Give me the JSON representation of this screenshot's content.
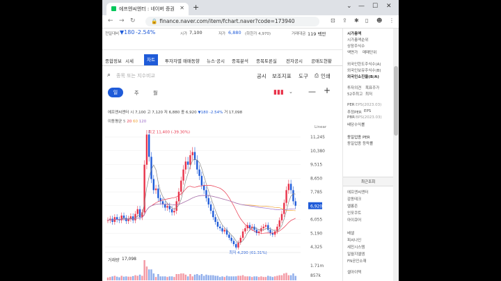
{
  "browser": {
    "tab_title": "에프엔씨엔터 : 네이버 증권",
    "url": "finance.naver.com/item/fchart.naver?code=173940"
  },
  "stock_header": {
    "prev_label": "전일대비",
    "change": "▼180",
    "change_pct": "-2.54%",
    "open_label": "시가",
    "open": "7,100",
    "low_label": "저가",
    "low": "6,880",
    "low_limit": "(하한가 4,970)",
    "amount_label": "거래대금",
    "amount": "119 백만"
  },
  "nav_tabs": [
    "종합정보",
    "시세",
    "차트",
    "투자자별 매매동향",
    "뉴스·공시",
    "종목분석",
    "종목토론실",
    "전자공시",
    "공매도현황"
  ],
  "active_tab": "차트",
  "search_placeholder": "종목 또는 지수비교",
  "toolbar": {
    "notice": "공시",
    "indicator": "보조지표",
    "tool": "도구",
    "print": "인쇄"
  },
  "periods": [
    "일",
    "주",
    "월"
  ],
  "active_period": "일",
  "ohlc_line": {
    "name": "에프엔씨엔터",
    "o_label": "시",
    "o": "7,100",
    "h_label": "고",
    "h": "7,120",
    "l_label": "저",
    "l": "6,880",
    "c_label": "종",
    "c": "6,920",
    "chg": "▼180 -2.54%",
    "v_label": "거",
    "v": "17,098"
  },
  "ma_line": {
    "label": "이동평균",
    "p1": "5",
    "p2": "20",
    "p3": "60",
    "p4": "120"
  },
  "scale_label": "Linear",
  "volume_label": "거래량",
  "volume_value": "17,098",
  "right_panel": {
    "items": [
      "시가총액",
      "시가총액순위",
      "상장주식수",
      "액면가",
      "매매단위",
      "외국인한도주식수(A)",
      "외국인보유주식수(B)",
      "외국인소진율(B/A)",
      "투자의견",
      "목표주가",
      "52주최고",
      "최저",
      "PER",
      "EPS(2023.03)",
      "추정PER",
      "EPS",
      "PBR",
      "BPS(2023.03)",
      "배당수익률",
      "동일업종 PER",
      "동일업종 등락률"
    ],
    "recent_title": "최근조회",
    "recent": [
      "에프엔씨엔터",
      "감동테크",
      "엘롱존",
      "인포쿠트",
      "아이큐어",
      "베셀",
      "피씨나인",
      "세진시스템",
      "일월지엘엠",
      "FN공인소재",
      "셀아이텍"
    ]
  },
  "chart_data": {
    "type": "candlestick",
    "y_axis_ticks": [
      "11,245",
      "10,380",
      "9,515",
      "8,650",
      "7,785",
      "6,920",
      "6,055",
      "5,190",
      "4,325"
    ],
    "ylim": [
      4325,
      11245
    ],
    "current_price": "6,920",
    "max_label": "최고 11,400 (-39.30%)",
    "min_label": "최저 4,290 (61.31%)",
    "volume_ticks": [
      "1.71m",
      "857k"
    ],
    "close_series": [
      6000,
      6100,
      5900,
      6200,
      6050,
      6000,
      6300,
      6150,
      5950,
      6100,
      6250,
      6000,
      6400,
      6700,
      6200,
      6500,
      9500,
      11400,
      10000,
      8600,
      7900,
      8000,
      7400,
      7200,
      7000,
      6800,
      6900,
      6700,
      6500,
      6600,
      7200,
      7800,
      8500,
      9200,
      9700,
      9500,
      10100,
      10300,
      9800,
      9200,
      8800,
      8200,
      7900,
      7400,
      7000,
      6600,
      6200,
      5900,
      5600,
      5500,
      5300,
      5400,
      5100,
      4900,
      4700,
      4500,
      4290,
      4600,
      4900,
      5300,
      5500,
      5700,
      5500,
      5600,
      5400,
      5200,
      5300,
      5500,
      5600,
      5700,
      5400,
      5200,
      5100,
      5300,
      5600,
      6000,
      6400,
      7100,
      7900,
      8300,
      7900,
      7200,
      6920
    ]
  }
}
